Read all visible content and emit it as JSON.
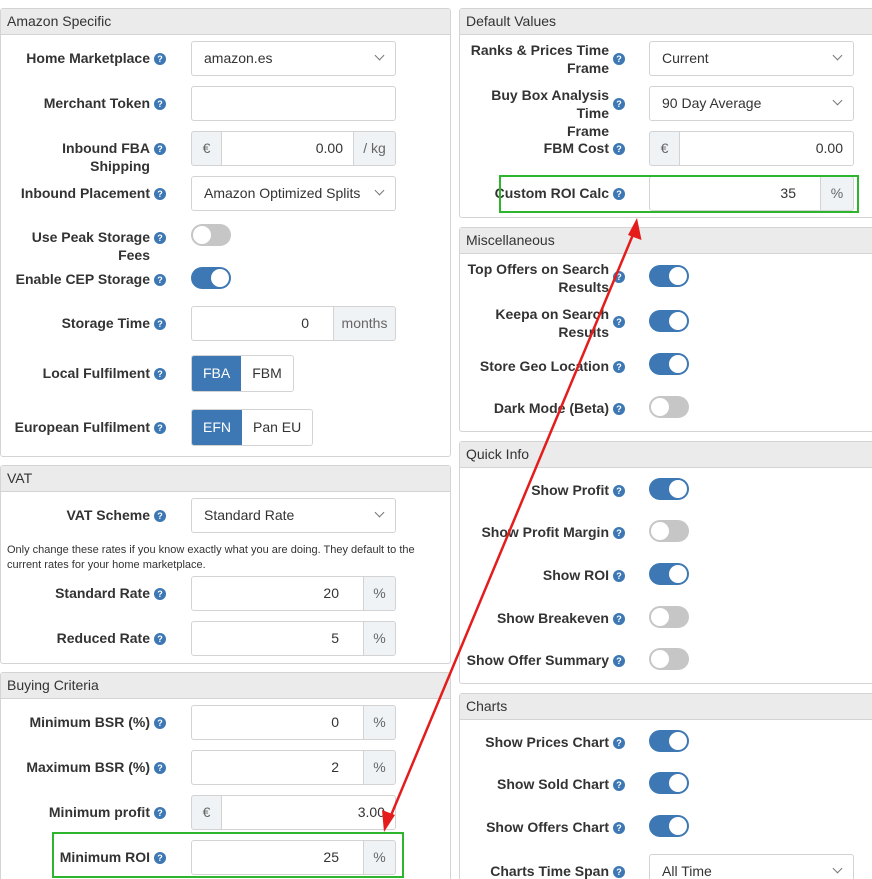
{
  "amazon": {
    "title": "Amazon Specific",
    "home_marketplace_label": "Home Marketplace",
    "home_marketplace_value": "amazon.es",
    "merchant_token_label": "Merchant Token",
    "merchant_token_value": "",
    "inbound_fba_label": "Inbound FBA Shipping",
    "inbound_fba_prefix": "€",
    "inbound_fba_value": "0.00",
    "inbound_fba_suffix": "/ kg",
    "inbound_placement_label": "Inbound Placement",
    "inbound_placement_value": "Amazon Optimized Splits",
    "peak_storage_label": "Use Peak Storage Fees",
    "peak_storage_on": false,
    "cep_storage_label": "Enable CEP Storage",
    "cep_storage_on": true,
    "storage_time_label": "Storage Time",
    "storage_time_value": "0",
    "storage_time_suffix": "months",
    "local_fulfilment_label": "Local Fulfilment",
    "local_fulfilment_options": [
      "FBA",
      "FBM"
    ],
    "european_fulfilment_label": "European Fulfilment",
    "european_fulfilment_options": [
      "EFN",
      "Pan EU"
    ]
  },
  "vat": {
    "title": "VAT",
    "scheme_label": "VAT Scheme",
    "scheme_value": "Standard Rate",
    "note": "Only change these rates if you know exactly what you are doing. They default to the current rates for your home marketplace.",
    "standard_label": "Standard Rate",
    "standard_value": "20",
    "reduced_label": "Reduced Rate",
    "reduced_value": "5",
    "pct": "%"
  },
  "buying": {
    "title": "Buying Criteria",
    "min_bsr_label": "Minimum BSR (%)",
    "min_bsr_value": "0",
    "max_bsr_label": "Maximum BSR (%)",
    "max_bsr_value": "2",
    "min_profit_label": "Minimum profit",
    "min_profit_prefix": "€",
    "min_profit_value": "3.00",
    "min_roi_label": "Minimum ROI",
    "min_roi_value": "25",
    "pct": "%"
  },
  "defaults": {
    "title": "Default Values",
    "ranks_label_1": "Ranks & Prices Time",
    "ranks_label_2": "Frame",
    "ranks_value": "Current",
    "buybox_label_1": "Buy Box Analysis Time",
    "buybox_label_2": "Frame",
    "buybox_value": "90 Day Average",
    "fbm_cost_label": "FBM Cost",
    "fbm_cost_prefix": "€",
    "fbm_cost_value": "0.00",
    "custom_roi_label": "Custom ROI Calc",
    "custom_roi_value": "35",
    "pct": "%"
  },
  "misc": {
    "title": "Miscellaneous",
    "top_offers_label_1": "Top Offers on Search",
    "top_offers_label_2": "Results",
    "top_offers_on": true,
    "keepa_label_1": "Keepa on Search",
    "keepa_label_2": "Results",
    "keepa_on": true,
    "geo_label": "Store Geo Location",
    "geo_on": true,
    "dark_label": "Dark Mode (Beta)",
    "dark_on": false
  },
  "quick": {
    "title": "Quick Info",
    "show_profit_label": "Show Profit",
    "show_profit_on": true,
    "show_margin_label": "Show Profit Margin",
    "show_margin_on": false,
    "show_roi_label": "Show ROI",
    "show_roi_on": true,
    "show_breakeven_label": "Show Breakeven",
    "show_breakeven_on": false,
    "show_offer_summary_label": "Show Offer Summary",
    "show_offer_summary_on": false
  },
  "charts": {
    "title": "Charts",
    "prices_label": "Show Prices Chart",
    "prices_on": true,
    "sold_label": "Show Sold Chart",
    "sold_on": true,
    "offers_label": "Show Offers Chart",
    "offers_on": true,
    "span_label": "Charts Time Span",
    "span_value": "All Time"
  },
  "help_glyph": "?",
  "colors": {
    "accent": "#3d78b4",
    "highlight": "#2db52d",
    "arrow": "#e51c1c",
    "toggle_off": "#c6c6c6"
  }
}
